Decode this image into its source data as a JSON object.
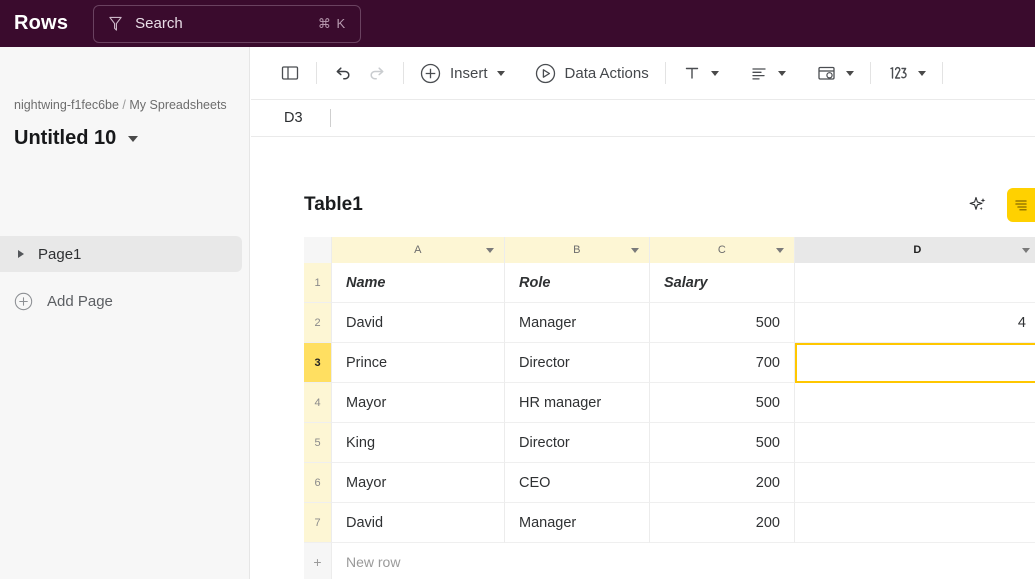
{
  "topbar": {
    "brand": "Rows",
    "search": {
      "icon": "search-icon",
      "placeholder": "Search",
      "shortcut": "⌘ K"
    }
  },
  "sidebar": {
    "breadcrumb": {
      "workspace": "nightwing-f1fec6be",
      "separator": "/",
      "folder": "My Spreadsheets"
    },
    "document_title": "Untitled 10",
    "pages": [
      {
        "label": "Page1",
        "selected": true
      }
    ],
    "add_page_label": "Add Page"
  },
  "toolbar": {
    "items": [
      {
        "name": "toggle-sidebar-icon",
        "label": ""
      },
      {
        "name": "undo-icon",
        "label": ""
      },
      {
        "name": "redo-icon",
        "label": ""
      },
      {
        "name": "insert-button",
        "label": "Insert"
      },
      {
        "name": "data-actions-button",
        "label": "Data Actions"
      },
      {
        "name": "text-format-button",
        "label": ""
      },
      {
        "name": "align-button",
        "label": ""
      },
      {
        "name": "cell-format-button",
        "label": ""
      },
      {
        "name": "number-format-button",
        "label": ""
      }
    ],
    "insert_label": "Insert",
    "data_actions_label": "Data Actions"
  },
  "formula_bar": {
    "cell_reference": "D3",
    "value": ""
  },
  "table": {
    "name": "Table1",
    "columns": [
      {
        "letter": "A",
        "selected": false
      },
      {
        "letter": "B",
        "selected": false
      },
      {
        "letter": "C",
        "selected": false
      },
      {
        "letter": "D",
        "selected": true
      }
    ],
    "rows": [
      {
        "num": "1",
        "active": false,
        "header": true,
        "cells": [
          "Name",
          "Role",
          "Salary",
          ""
        ]
      },
      {
        "num": "2",
        "active": false,
        "header": false,
        "cells": [
          "David",
          "Manager",
          "500",
          "4"
        ]
      },
      {
        "num": "3",
        "active": true,
        "header": false,
        "cells": [
          "Prince",
          "Director",
          "700",
          ""
        ]
      },
      {
        "num": "4",
        "active": false,
        "header": false,
        "cells": [
          "Mayor",
          "HR manager",
          "500",
          ""
        ]
      },
      {
        "num": "5",
        "active": false,
        "header": false,
        "cells": [
          "King",
          "Director",
          "500",
          ""
        ]
      },
      {
        "num": "6",
        "active": false,
        "header": false,
        "cells": [
          "Mayor",
          "CEO",
          "200",
          ""
        ]
      },
      {
        "num": "7",
        "active": false,
        "header": false,
        "cells": [
          "David",
          "Manager",
          "200",
          ""
        ]
      }
    ],
    "new_row_label": "New row",
    "new_row_plus": "+",
    "selected_cell": "D3"
  },
  "colors": {
    "topbar_bg": "#3a0b2d",
    "accent_yellow": "#ffc700",
    "row_header_yellow": "#fdf6d4",
    "active_row_yellow": "#ffdf61",
    "sidebar_bg": "#f7f7f7"
  }
}
